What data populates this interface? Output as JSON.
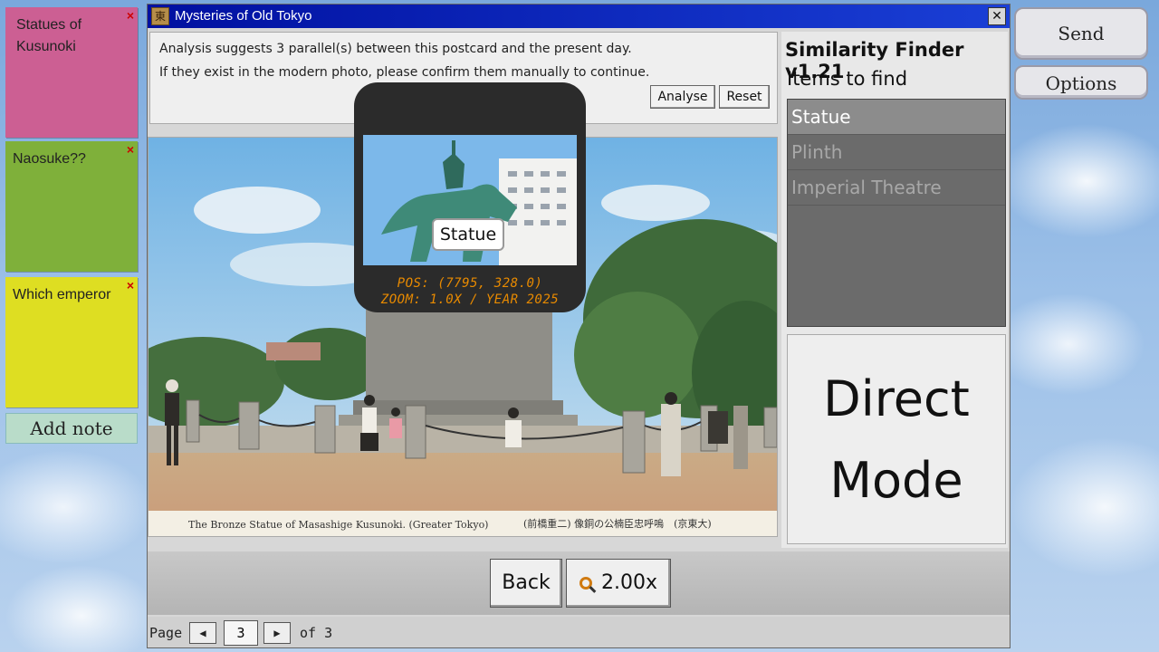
{
  "notes": [
    {
      "text": "Statues of Kusunoki",
      "color": "#cc5f93"
    },
    {
      "text": "Naosuke??",
      "color": "#7fb03a"
    },
    {
      "text": "Which emperor",
      "color": "#dede22"
    }
  ],
  "note_close_glyph": "×",
  "add_note_label": "Add note",
  "side_buttons": {
    "feedback": "Send Feedback",
    "options": "Options"
  },
  "window": {
    "title": "Mysteries of Old Tokyo",
    "icon_glyph": "東",
    "close_glyph": "✕"
  },
  "analysis": {
    "line1": "Analysis suggests 3 parallel(s) between this postcard and the present day.",
    "line2": "If they exist in the modern photo, please confirm them manually to continue.",
    "analyse_label": "Analyse",
    "reset_label": "Reset"
  },
  "postcard": {
    "caption_en": "The Bronze Statue of Masashige Kusunoki. (Greater Tokyo)",
    "caption_jp": "(前橋重二) 像銅の公楠臣忠呼嗚　(京東大)"
  },
  "popup": {
    "label": "Statue",
    "pos_readout": "POS: (7795, 328.0)",
    "zoom_readout": "ZOOM: 1.0X / YEAR 2025"
  },
  "finder": {
    "title": "Similarity Finder v1.21",
    "subtitle": "Items to find",
    "items": [
      {
        "label": "Statue",
        "active": true
      },
      {
        "label": "Plinth",
        "active": false
      },
      {
        "label": "Imperial Theatre",
        "active": false
      }
    ],
    "mode_line1": "Direct",
    "mode_line2": "Mode"
  },
  "controls": {
    "back_label": "Back",
    "zoom_label": "2.00x"
  },
  "pager": {
    "label": "Page",
    "prev_glyph": "◀",
    "next_glyph": "▶",
    "current": "3",
    "of_text": "of 3"
  },
  "colors": {
    "titlebar": "#0010a0",
    "readout": "#e88a00",
    "close_x": "#cc0000"
  }
}
